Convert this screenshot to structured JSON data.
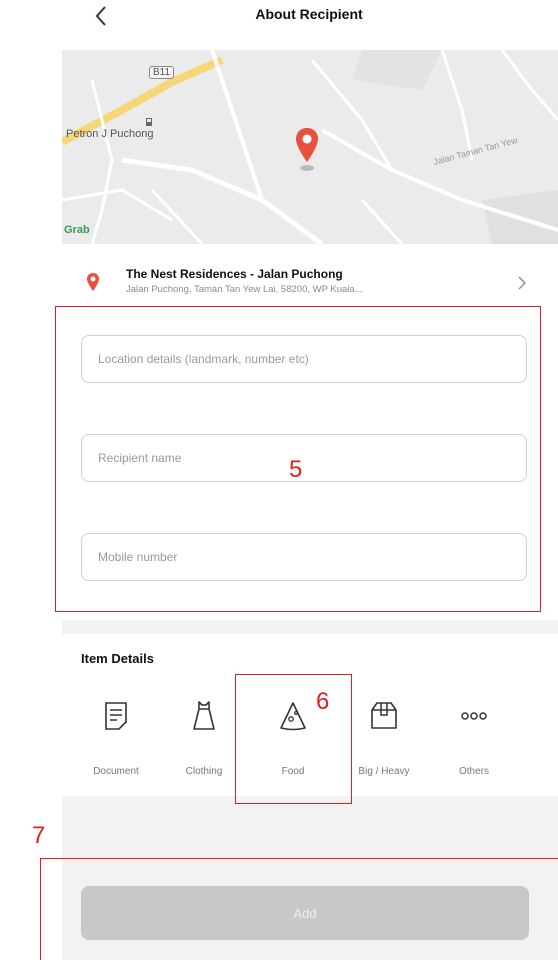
{
  "header": {
    "title": "About Recipient"
  },
  "map": {
    "road_badge": "B11",
    "poi_label": "Petron J Puchong",
    "street_label": "Jalan Taman Tan Yew",
    "watermark": "Grab"
  },
  "location": {
    "title": "The Nest Residences - Jalan Puchong",
    "address": "Jalan Puchong, Taman Tan Yew Lai, 58200, WP Kuala..."
  },
  "form": {
    "location_details_placeholder": "Location details (landmark, number etc)",
    "recipient_name_placeholder": "Recipient name",
    "mobile_number_placeholder": "Mobile number"
  },
  "item_details": {
    "title": "Item Details",
    "categories": [
      {
        "label": "Document",
        "icon": "document-icon"
      },
      {
        "label": "Clothing",
        "icon": "clothing-icon"
      },
      {
        "label": "Food",
        "icon": "food-icon"
      },
      {
        "label": "Big / Heavy",
        "icon": "box-icon"
      },
      {
        "label": "Others",
        "icon": "more-icon"
      }
    ]
  },
  "add_button": {
    "label": "Add"
  },
  "annotations": {
    "form_box": "5",
    "food_box": "6",
    "add_box": "7"
  },
  "colors": {
    "accent": "#e8513f",
    "annotation": "#e02020",
    "disabled_button": "#c8c8c8"
  }
}
